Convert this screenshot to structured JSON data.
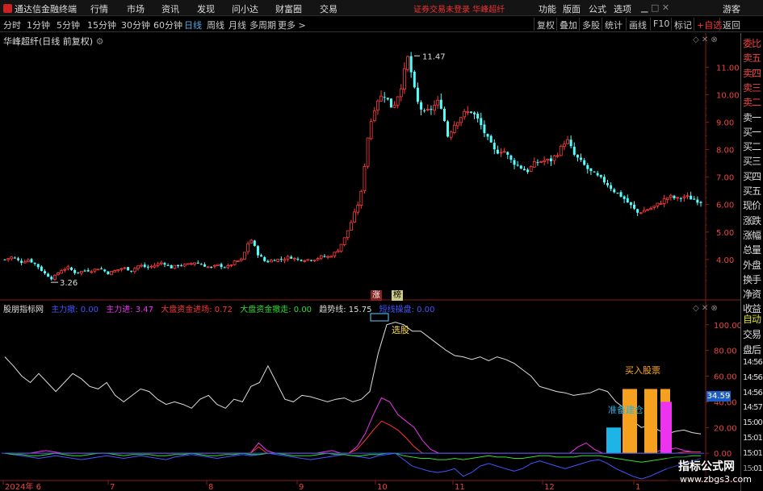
{
  "titlebar": {
    "app_name": "通达信金融终端",
    "menus": [
      "行情",
      "市场",
      "资讯",
      "发现",
      "问小达",
      "财富圈",
      "交易"
    ],
    "status": "证券交易未登录  华峰超纤",
    "right_items": [
      "功能",
      "版面",
      "公式",
      "选项"
    ],
    "user": "游客"
  },
  "toolbar": {
    "periods": [
      "分时",
      "1分钟",
      "5分钟",
      "15分钟",
      "30分钟",
      "60分钟",
      "日线",
      "周线",
      "月线",
      "多周期",
      "更多 >"
    ],
    "active_period": "日线",
    "buttons": [
      "复权",
      "叠加",
      "多股",
      "统计",
      "画线",
      "F10",
      "标记",
      "+自选",
      "返回"
    ]
  },
  "upper_panel": {
    "title": "华峰超纤(日线 前复权)",
    "high_label": "11.47",
    "low_label": "3.26",
    "tag_zhang": "涨",
    "tag_bang": "榜"
  },
  "lower_panel": {
    "indicator_name": "股朋指标网",
    "items": [
      {
        "label": "主力撤: 0.00",
        "color": "#4455ff"
      },
      {
        "label": "主力进: 3.47",
        "color": "#ee33ee"
      },
      {
        "label": "大盘资金进场: 0.72",
        "color": "#ff3333"
      },
      {
        "label": "大盘资金撤走: 0.00",
        "color": "#33dd33"
      },
      {
        "label": "趋势线: 15.75",
        "color": "#dddddd"
      },
      {
        "label": "短线操盘: 0.00",
        "color": "#4455ff"
      }
    ],
    "anno_select": "选股",
    "anno_buy": "买入股票",
    "anno_prepare": "准备建仓",
    "value_badge": "34.59"
  },
  "side_panel": {
    "items": [
      "委比",
      "卖五",
      "卖四",
      "卖三",
      "卖二",
      "卖一",
      "买一",
      "买二",
      "买三",
      "买四",
      "买五",
      "现价",
      "涨跌",
      "涨幅",
      "总量",
      "外盘",
      "换手",
      "净资",
      "收益",
      "自动",
      "交易",
      "盘后",
      "14:56",
      "14:56",
      "14:56",
      "14:57",
      "15:00",
      "15:01",
      "15:01",
      "15:01"
    ]
  },
  "watermark": {
    "line1": "指标公式网",
    "line2": "www.zbgs3.com"
  },
  "chart_data": [
    {
      "type": "candlestick",
      "title": "华峰超纤(日线 前复权)",
      "y_ticks": [
        "11.00",
        "10.00",
        "9.00",
        "8.00",
        "7.00",
        "6.00",
        "5.00",
        "4.00"
      ],
      "ylim": [
        3.0,
        11.8
      ],
      "x_ticks": [
        "2024年 6",
        "7",
        "8",
        "9",
        "10",
        "11",
        "12",
        "1"
      ],
      "annotations": {
        "high": 11.47,
        "low": 3.26
      },
      "close_path": [
        4.0,
        4.1,
        3.9,
        4.0,
        3.8,
        3.5,
        3.3,
        3.6,
        3.7,
        3.5,
        3.6,
        3.6,
        3.7,
        3.5,
        3.6,
        3.7,
        3.6,
        3.8,
        3.7,
        3.8,
        3.9,
        3.7,
        3.8,
        3.8,
        3.9,
        3.8,
        3.7,
        3.8,
        3.7,
        3.9,
        4.0,
        4.8,
        4.2,
        3.9,
        4.0,
        4.0,
        4.1,
        4.0,
        4.0,
        4.0,
        4.1,
        4.1,
        4.3,
        4.8,
        5.5,
        6.3,
        8.7,
        9.8,
        10.0,
        9.5,
        10.2,
        11.4,
        9.8,
        9.3,
        9.5,
        9.8,
        8.5,
        9.0,
        9.3,
        9.4,
        9.0,
        8.4,
        7.9,
        8.0,
        7.6,
        7.4,
        7.2,
        7.5,
        7.6,
        7.6,
        7.9,
        8.4,
        7.8,
        7.5,
        7.2,
        7.0,
        6.8,
        6.5,
        6.3,
        6.0,
        5.7,
        5.8,
        5.9,
        6.1,
        6.3,
        6.2,
        6.3,
        6.2,
        6.1
      ]
    },
    {
      "type": "line",
      "title": "股朋指标网",
      "y_ticks": [
        "100.00",
        "80.00",
        "60.00",
        "40.00",
        "20.00",
        "0.00"
      ],
      "ylim": [
        -20,
        108
      ],
      "series": [
        {
          "name": "趋势线",
          "color": "#dddddd",
          "values": [
            75,
            68,
            60,
            55,
            62,
            55,
            48,
            55,
            62,
            58,
            52,
            50,
            55,
            45,
            40,
            45,
            50,
            48,
            42,
            38,
            40,
            38,
            35,
            42,
            45,
            38,
            35,
            42,
            40,
            52,
            55,
            68,
            55,
            42,
            40,
            45,
            44,
            42,
            40,
            42,
            43,
            40,
            42,
            48,
            78,
            100,
            102,
            100,
            95,
            95,
            90,
            85,
            80,
            76,
            75,
            73,
            75,
            72,
            75,
            73,
            70,
            65,
            60,
            52,
            50,
            48,
            47,
            45,
            46,
            47,
            50,
            48,
            40,
            35,
            25,
            20,
            22,
            18,
            15,
            17,
            18,
            16,
            15
          ]
        },
        {
          "name": "主力进",
          "color": "#ee33ee",
          "values": [
            0,
            0,
            0,
            0,
            1,
            2,
            1,
            0,
            0,
            0,
            0,
            0,
            0,
            0,
            0,
            0,
            0,
            0,
            0,
            0,
            0,
            0,
            0,
            0,
            0,
            0,
            0,
            0,
            0,
            0,
            0,
            8,
            2,
            0,
            0,
            0,
            0,
            0,
            0,
            1,
            2,
            0,
            0,
            5,
            15,
            30,
            43,
            40,
            30,
            25,
            20,
            10,
            3,
            0,
            0,
            0,
            0,
            0,
            0,
            0,
            0,
            0,
            0,
            0,
            0,
            0,
            0,
            0,
            0,
            0,
            5,
            8,
            3,
            0,
            0,
            0,
            0,
            0,
            0,
            0,
            2,
            3,
            4,
            2,
            1,
            1
          ]
        },
        {
          "name": "大盘资金进场",
          "color": "#ff3333",
          "values": [
            0,
            0,
            0,
            0,
            0,
            0,
            0,
            0,
            0,
            0,
            0,
            0,
            0,
            0,
            0,
            0,
            0,
            0,
            0,
            0,
            0,
            0,
            0,
            0,
            0,
            0,
            0,
            0,
            0,
            0,
            0,
            5,
            0,
            0,
            0,
            0,
            0,
            0,
            0,
            0,
            0,
            0,
            0,
            3,
            10,
            18,
            25,
            22,
            18,
            12,
            5,
            0,
            0,
            0,
            0,
            0,
            0,
            0,
            0,
            0,
            0,
            0,
            0,
            0,
            0,
            0,
            0,
            0,
            0,
            0,
            0,
            0,
            0,
            0,
            0,
            0,
            0,
            0,
            0,
            0,
            0,
            0,
            0,
            1,
            1,
            1
          ]
        },
        {
          "name": "主力撤",
          "color": "#4455ff",
          "values": [
            0,
            -1,
            -2,
            -3,
            -4,
            -3,
            -2,
            -3,
            -4,
            -5,
            -4,
            -3,
            -2,
            -3,
            -4,
            -3,
            -2,
            -3,
            -4,
            -5,
            -3,
            -2,
            -1,
            -2,
            -3,
            -4,
            -3,
            -2,
            -1,
            -2,
            -1,
            0,
            -1,
            -2,
            -3,
            -4,
            -5,
            -4,
            -3,
            -2,
            -1,
            -2,
            -3,
            -4,
            -2,
            -1,
            0,
            -5,
            -10,
            -12,
            -14,
            -15,
            -14,
            -12,
            -18,
            -15,
            -10,
            -8,
            -10,
            -12,
            -14,
            -12,
            -8,
            -6,
            -8,
            -10,
            -12,
            -10,
            -8,
            -6,
            -5,
            -8,
            -12,
            -15,
            -18,
            -20,
            -18,
            -15,
            -12,
            -10,
            -8,
            -6,
            -4
          ]
        },
        {
          "name": "大盘资金撤走",
          "color": "#33dd33",
          "values": [
            0,
            -1,
            -1,
            -2,
            -2,
            -1,
            0,
            -1,
            -2,
            -2,
            -1,
            0,
            0,
            -1,
            -2,
            -1,
            -1,
            -1,
            -2,
            -2,
            -1,
            -1,
            0,
            -1,
            -2,
            -2,
            -1,
            -1,
            0,
            -1,
            -1,
            0,
            0,
            -1,
            -2,
            -2,
            -2,
            -1,
            0,
            -1,
            -1,
            -2,
            -2,
            -1,
            -1,
            0,
            0,
            -2,
            -3,
            -4,
            -4,
            -5,
            -5,
            -4,
            -5,
            -4,
            -3,
            -2,
            -3,
            -3,
            -4,
            -4,
            -3,
            -2,
            -2,
            -3,
            -3,
            -3,
            -2,
            -2,
            -2,
            -3,
            -4,
            -5,
            -6,
            -7,
            -6,
            -5,
            -4,
            -3,
            -3,
            -2,
            -2
          ]
        }
      ],
      "bars": [
        {
          "color": "#1eb4e6",
          "value": 20
        },
        {
          "color": "#f5a01e",
          "value": 50
        },
        {
          "color": "#f5a01e",
          "value": 50
        },
        {
          "color": "#f5a01e",
          "value": 50
        },
        {
          "color": "#ee33ee",
          "value": 40
        }
      ]
    }
  ]
}
